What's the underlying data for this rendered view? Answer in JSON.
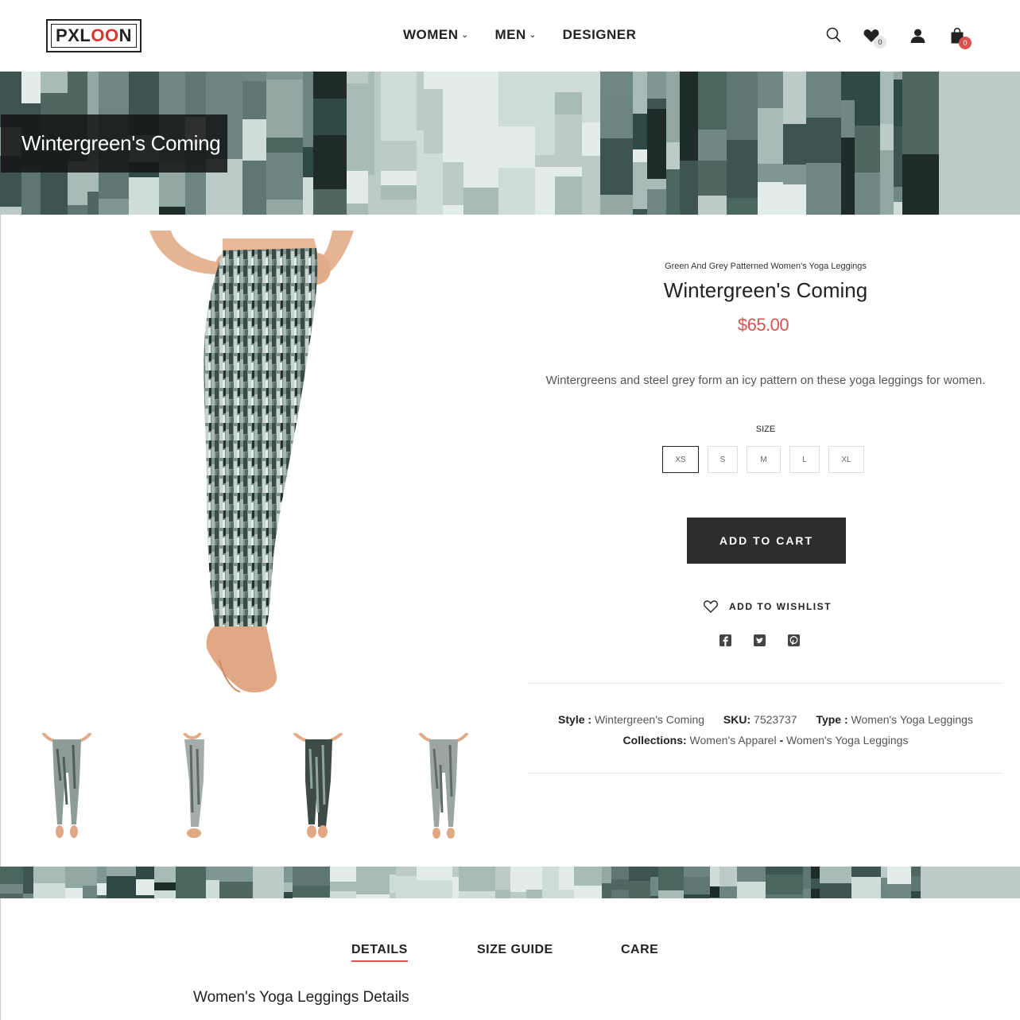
{
  "header": {
    "logo": "PXLOON",
    "nav": [
      {
        "label": "WOMEN",
        "has_dropdown": true
      },
      {
        "label": "MEN",
        "has_dropdown": true
      },
      {
        "label": "DESIGNER",
        "has_dropdown": false
      }
    ],
    "wishlist_count": "0",
    "cart_count": "0",
    "icons": [
      "search-icon",
      "heart-icon",
      "user-icon",
      "bag-icon"
    ]
  },
  "banner": {
    "title": "Wintergreen's Coming"
  },
  "product": {
    "subtitle": "Green And Grey Patterned Women's Yoga Leggings",
    "title": "Wintergreen's Coming",
    "price": "$65.00",
    "description": "Wintergreens and steel grey form an icy pattern on these yoga leggings for women.",
    "size_label": "SIZE",
    "sizes": [
      "XS",
      "S",
      "M",
      "L",
      "XL"
    ],
    "selected_size": "XS",
    "add_to_cart": "ADD TO CART",
    "add_to_wishlist": "ADD TO WISHLIST",
    "social": [
      "facebook-icon",
      "twitter-icon",
      "pinterest-icon"
    ],
    "meta": {
      "style_label": "Style :",
      "style_value": "Wintergreen's Coming",
      "sku_label": "SKU:",
      "sku_value": "7523737",
      "type_label": "Type :",
      "type_value": "Women's Yoga Leggings",
      "collections_label": "Collections:",
      "collection_1": "Women's Apparel",
      "separator": "-",
      "collection_2": "Women's Yoga Leggings"
    }
  },
  "tabs": [
    {
      "label": "DETAILS",
      "active": true
    },
    {
      "label": "SIZE GUIDE",
      "active": false
    },
    {
      "label": "CARE",
      "active": false
    }
  ],
  "details": {
    "title": "Women's Yoga Leggings Details"
  },
  "colors": {
    "accent": "#d9534f",
    "dark_button": "#2d2d2d",
    "pattern_dark": "#2f4a46",
    "pattern_light": "#c9d6d1"
  }
}
